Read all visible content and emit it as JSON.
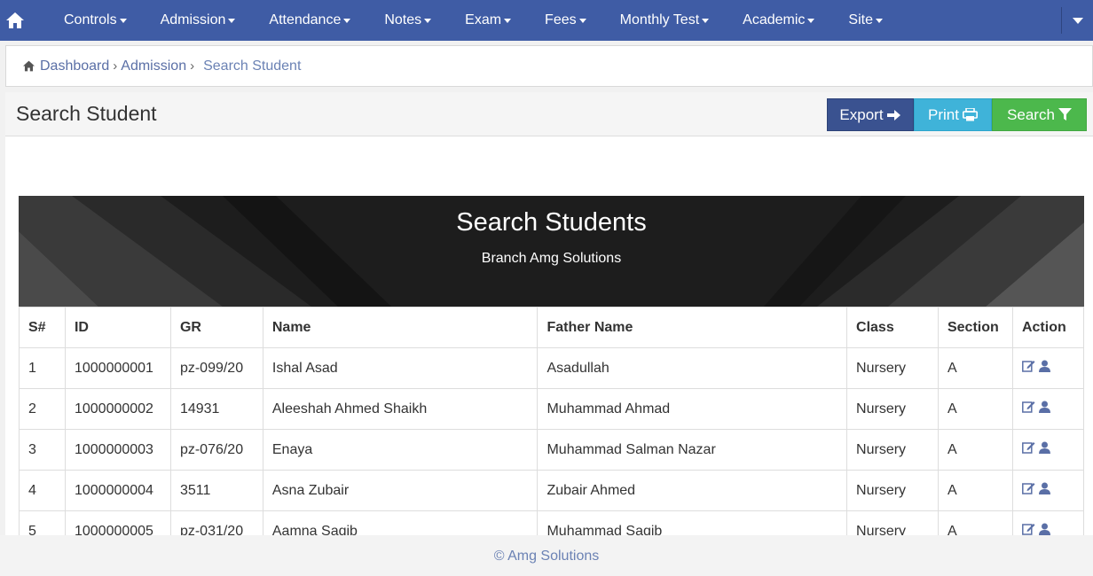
{
  "nav": {
    "items": [
      {
        "label": "Controls"
      },
      {
        "label": "Admission"
      },
      {
        "label": "Attendance"
      },
      {
        "label": "Notes"
      },
      {
        "label": "Exam"
      },
      {
        "label": "Fees"
      },
      {
        "label": "Monthly Test"
      },
      {
        "label": "Academic"
      },
      {
        "label": "Site"
      }
    ]
  },
  "breadcrumb": {
    "items": [
      "Dashboard",
      "Admission"
    ],
    "current": "Search Student"
  },
  "panel": {
    "title": "Search Student",
    "buttons": {
      "export": "Export",
      "print": "Print",
      "search": "Search"
    }
  },
  "banner": {
    "title": "Search Students",
    "subtitle": "Branch Amg Solutions"
  },
  "table": {
    "headers": [
      "S#",
      "ID",
      "GR",
      "Name",
      "Father Name",
      "Class",
      "Section",
      "Action"
    ],
    "rows": [
      {
        "sn": "1",
        "id": "1000000001",
        "gr": "pz-099/20",
        "name": "Ishal Asad",
        "father": "Asadullah",
        "class": "Nursery",
        "section": "A"
      },
      {
        "sn": "2",
        "id": "1000000002",
        "gr": "14931",
        "name": "Aleeshah Ahmed Shaikh",
        "father": "Muhammad Ahmad",
        "class": "Nursery",
        "section": "A"
      },
      {
        "sn": "3",
        "id": "1000000003",
        "gr": "pz-076/20",
        "name": "Enaya",
        "father": "Muhammad Salman Nazar",
        "class": "Nursery",
        "section": "A"
      },
      {
        "sn": "4",
        "id": "1000000004",
        "gr": "3511",
        "name": "Asna Zubair",
        "father": "Zubair Ahmed",
        "class": "Nursery",
        "section": "A"
      },
      {
        "sn": "5",
        "id": "1000000005",
        "gr": "pz-031/20",
        "name": "Aamna Saqib",
        "father": "Muhammad Saqib",
        "class": "Nursery",
        "section": "A"
      }
    ]
  },
  "footer": {
    "text": "© Amg Solutions"
  },
  "colors": {
    "navbar": "#3f5ca5",
    "export": "#3a5290",
    "print": "#3fb3d9",
    "search": "#4cb84c",
    "link": "#5a6fa6"
  }
}
